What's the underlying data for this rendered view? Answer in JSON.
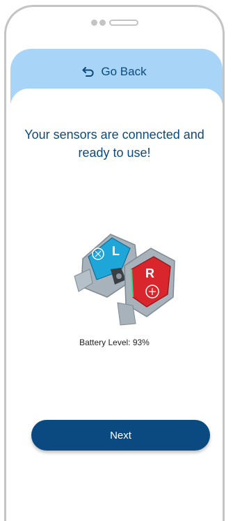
{
  "header": {
    "back_label": "Go Back"
  },
  "main": {
    "headline": "Your sensors are connected and ready to use!",
    "battery_text": "Battery Level: 93%",
    "next_label": "Next"
  },
  "sensors": {
    "left_letter": "L",
    "right_letter": "R"
  },
  "colors": {
    "header_bg": "#a8d4f7",
    "primary": "#0b4a80",
    "left_sensor": "#1fa6d9",
    "right_sensor": "#d9262c"
  },
  "icons": {
    "back": "return-arrow-icon"
  }
}
